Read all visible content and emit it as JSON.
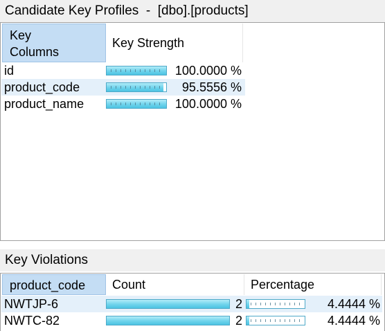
{
  "key_profiles": {
    "title": "Candidate Key Profiles  -  [dbo].[products]",
    "columns": {
      "key_columns": "Key\nColumns",
      "key_strength": "Key Strength"
    },
    "rows": [
      {
        "column": "id",
        "strength_text": "100.0000 %",
        "strength": 1.0
      },
      {
        "column": "product_code",
        "strength_text": "95.5556 %",
        "strength": 0.955556
      },
      {
        "column": "product_name",
        "strength_text": "100.0000 %",
        "strength": 1.0
      }
    ]
  },
  "key_violations": {
    "title": "Key Violations",
    "columns": {
      "product_code": "product_code",
      "count": "Count",
      "percentage": "Percentage"
    },
    "rows": [
      {
        "code": "NWTJP-6",
        "count": "2",
        "count_fraction": 1.0,
        "percentage_text": "4.4444 %",
        "percentage": 0.044444
      },
      {
        "code": "NWTC-82",
        "count": "2",
        "count_fraction": 1.0,
        "percentage_text": "4.4444 %",
        "percentage": 0.044444
      }
    ]
  },
  "colors": {
    "header_selected": "#c4ddf4",
    "row_highlight": "#e4f0fa",
    "bar_fill": "#6fd3ec",
    "bar_border": "#4ea9c8"
  }
}
